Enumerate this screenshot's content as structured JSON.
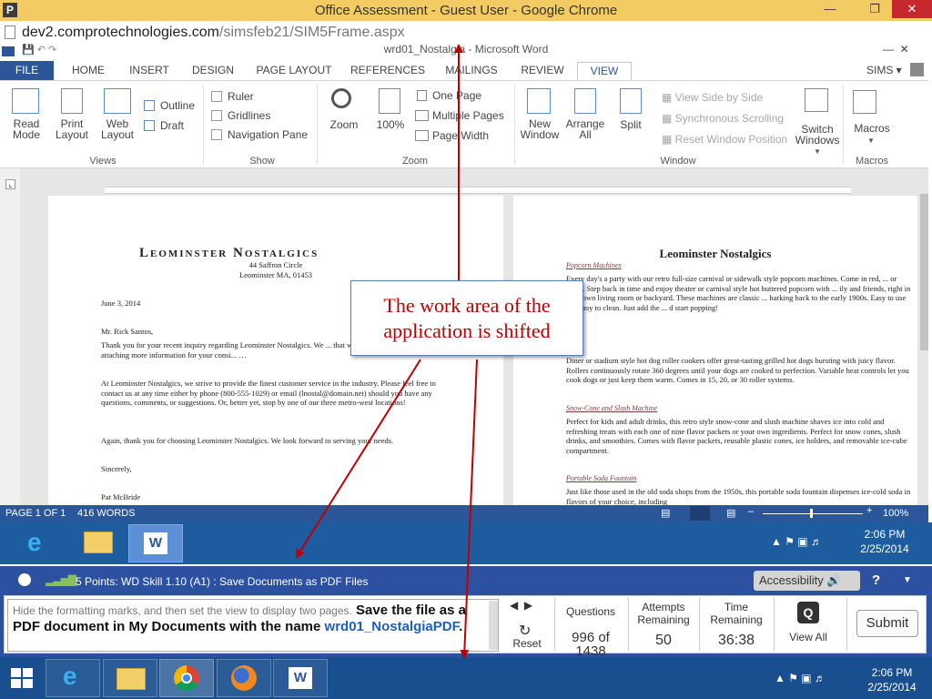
{
  "browser": {
    "title": "Office Assessment - Guest User - Google Chrome",
    "url_host": "dev2.comprotechnologies.com",
    "url_path": "/simsfeb21/SIM5Frame.aspx"
  },
  "word": {
    "title": "wrd01_Nostalgia - Microsoft Word",
    "tabs": [
      "FILE",
      "HOME",
      "INSERT",
      "DESIGN",
      "PAGE LAYOUT",
      "REFERENCES",
      "MAILINGS",
      "REVIEW",
      "VIEW"
    ],
    "user": "SIMS",
    "views": {
      "read_mode": "Read\nMode",
      "print_layout": "Print\nLayout",
      "web_layout": "Web\nLayout",
      "outline": "Outline",
      "draft": "Draft",
      "group": "Views"
    },
    "show": {
      "ruler": "Ruler",
      "gridlines": "Gridlines",
      "navigation_pane": "Navigation Pane",
      "group": "Show"
    },
    "zoom": {
      "zoom": "Zoom",
      "hundred": "100%",
      "one_page": "One Page",
      "multiple_pages": "Multiple Pages",
      "page_width": "Page Width",
      "group": "Zoom"
    },
    "window": {
      "new_window": "New\nWindow",
      "arrange_all": "Arrange\nAll",
      "split": "Split",
      "side_by_side": "View Side by Side",
      "sync_scrolling": "Synchronous Scrolling",
      "reset_position": "Reset Window Position",
      "switch_windows": "Switch\nWindows",
      "group": "Window"
    },
    "macros": {
      "macros": "Macros",
      "group": "Macros"
    },
    "status": {
      "page": "PAGE 1 OF 1",
      "words": "416 WORDS",
      "zoom": "100%"
    }
  },
  "letter": {
    "heading": "Leominster Nostalgics",
    "address1": "44 Saffron Circle",
    "address2": "Leominster MA, 01453",
    "date": "June 3, 2014",
    "salutation": "Mr. Rick Santos,",
    "p1": "Thank you for your recent inquiry regarding Leominster Nostalgics. We ... that will suit your needs. I'm attaching more information for your consi... …",
    "p2": "At Leominster Nostalgics, we strive to provide the finest customer service in the industry. Please feel free to contact us at any time either by phone (800-555-1029) or email (lnostal@domain.net) should you have any questions, comments, or suggestions. Or, better yet, stop by one of our three metro-west locations!",
    "p3": "Again, thank you for choosing Leominster Nostalgics. We look forward to serving your needs.",
    "closing": "Sincerely,",
    "signature": "Pat McBride"
  },
  "page2": {
    "heading": "Leominster Nostalgics",
    "s1": "Popcorn Machines",
    "s1_text": "Every day's a party with our retro full-size carnival or sidewalk style popcorn machines. Come in red, ... or black. Step back in time and enjoy theater or carnival style hot buttered popcorn with ... ily and friends, right in your own living room or backyard. These machines are classic ... harking back to the early 1900s. Easy to use and easy to clean. Just add the ... d start popping!",
    "s2_text": "Diner or stadium style hot dog roller cookers offer great-tasting grilled hot dogs bursting with juicy flavor. Rollers continuously rotate 360 degrees until your dogs are cooked to perfection. Variable heat controls let you cook dogs or just keep them warm. Comes in 15, 20, or 30 roller systems.",
    "s3": "Snow-Cone and Slush Machine",
    "s3_text": "Perfect for kids and adult drinks, this retro style snow-cone and slush machine shaves ice into cold and refreshing treats with each one of nine flavor packets or your own ingredients. Perfect for snow cones, slush drinks, and smoothies. Comes with flavor packets, reusable plastic cones, ice holders, and removable ice-cube compartment.",
    "s4": "Portable Soda Fountain",
    "s4_text": "Just like those used in the old soda shops from the 1950s, this portable soda fountain dispenses ice-cold soda in flavors of your choice, including"
  },
  "callout": "The work area of the application is shifted",
  "taskbar": {
    "time": "2:06 PM",
    "date": "2/25/2014"
  },
  "sims": {
    "task_title": "5 Points: WD Skill 1.10 (A1) : Save Documents as PDF Files",
    "accessibility": "Accessibility",
    "help": "?",
    "instruction_gray": "Hide the formatting marks, and then set the view to display two pages.",
    "instruction_bold": "Save the file as a PDF document in My Documents with the name",
    "instruction_file": "wrd01_NostalgiaPDF",
    "instruction_end": ".",
    "reset": "Reset",
    "questions_label": "Questions",
    "questions_value": "996 of 1438",
    "attempts_label": "Attempts Remaining",
    "attempts_value": "50",
    "time_label": "Time Remaining",
    "time_value": "36:38",
    "view_all": "View All",
    "submit": "Submit"
  },
  "colors": {
    "word_blue": "#2b579a",
    "callout_text": "#c00000",
    "arrow": "#c00000",
    "sims_bar": "#2d51a1"
  }
}
